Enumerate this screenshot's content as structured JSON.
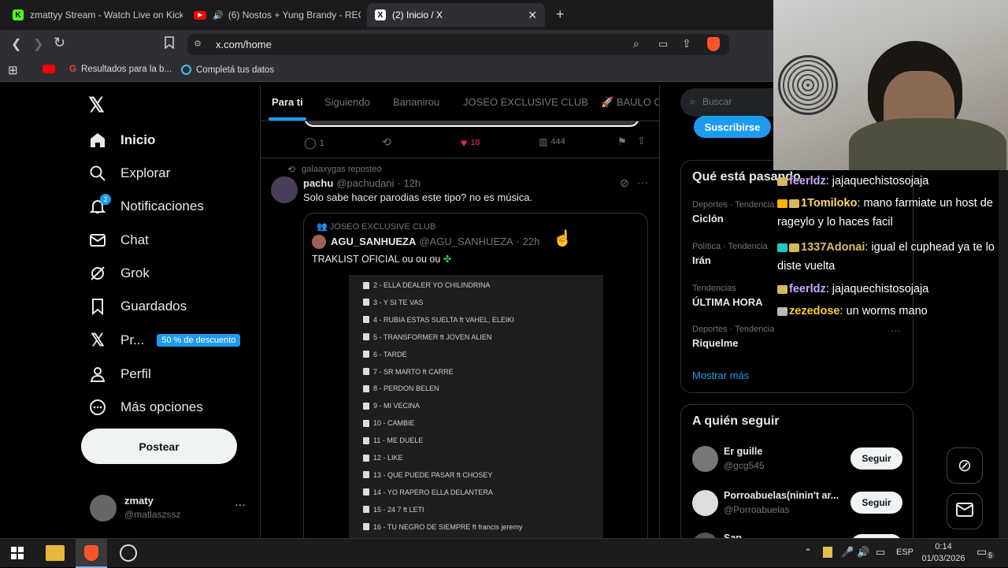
{
  "browser": {
    "tabs": [
      {
        "label": "zmattyy Stream - Watch Live on Kick",
        "icon": "kick-icon"
      },
      {
        "label": "(6) Nostos + Yung Brandy - RECU",
        "icon": "youtube-icon"
      },
      {
        "label": "(2) Inicio / X",
        "icon": "x-logo-icon"
      }
    ],
    "url": "x.com/home",
    "bookmarks": [
      "Resultados para la b...",
      "Completá tus datos"
    ]
  },
  "nav": {
    "items": [
      "Inicio",
      "Explorar",
      "Notificaciones",
      "Chat",
      "Grok",
      "Guardados",
      "Pr...",
      "Perfil",
      "Más opciones"
    ],
    "premium_badge": "50 % de descuento",
    "notif_count": "2",
    "post_button": "Postear",
    "account": {
      "name": "zmaty",
      "handle": "@matlaszssz"
    }
  },
  "feed": {
    "tabs": [
      "Para ti",
      "Siguiendo",
      "Bananirou",
      "JOSEO EXCLUSIVE CLUB",
      "BAULO CL"
    ],
    "prev_actions": {
      "replies": "1",
      "likes": "18",
      "views": "444"
    },
    "tweet": {
      "repost": "galaaxygas reposteó",
      "name": "pachu",
      "handle": "@pachudani",
      "time": "· 12h",
      "text": "Solo sabe hacer parodias este tipo? no es música.",
      "quote": {
        "community": "JOSEO EXCLUSIVE CLUB",
        "name": "AGU_SANHUEZA",
        "handle": "@AGU_SANHUEZA",
        "time": "· 22h",
        "text": "TRAKLIST OFICIAL ou ou ou",
        "tracks": [
          "2 - ELLA DEALER YO CHILINDRINA",
          "3 - Y SI TE VAS",
          "4 - RUBIA ESTAS SUELTA ft VAHEL, ELEIKI",
          "5 - TRANSFORMER ft JOVEN ALIEN",
          "6 - TARDE",
          "7 - SR MARTO ft CARRE",
          "8 - PERDON BELEN",
          "9 - MI VECINA",
          "10 - CAMBIE",
          "11 - ME DUELE",
          "12 - LIKE",
          "13 - QUE PUEDE PASAR ft CHOSEY",
          "14 - YO RAPERO ELLA DELANTERA",
          "15 - 24 7 ft LETI",
          "16 - TU NEGRO DE SIEMPRE ft francis jeremy"
        ]
      }
    }
  },
  "sidebar": {
    "search_placeholder": "Buscar",
    "subscribe": "Suscribirse",
    "trends_title": "Qué está pasando",
    "trends": [
      {
        "cat": "Deportes · Tendencia",
        "name": "Ciclón"
      },
      {
        "cat": "Política · Tendencia",
        "name": "Irán"
      },
      {
        "cat": "Tendencias",
        "name": "ÚLTIMA HORA"
      },
      {
        "cat": "Deportes · Tendencia",
        "name": "Riquelme"
      }
    ],
    "show_more": "Mostrar más",
    "follow_title": "A quién seguir",
    "follow": [
      {
        "name": "Er guille",
        "handle": "@gcg545",
        "btn": "Seguir"
      },
      {
        "name": "Porroabuelas(ninin't ar...",
        "handle": "@Porroabuelas",
        "btn": "Seguir"
      },
      {
        "name": "Sap",
        "handle": "",
        "btn": "Seguir"
      }
    ]
  },
  "chat": [
    {
      "user": "feerldz",
      "color": "#c8a8ff",
      "msg": ": jajaquechistosojaja"
    },
    {
      "user": "1Tomiloko",
      "color": "#ffd966",
      "msg": ": mano farmiate un host de rageylo y lo haces facil"
    },
    {
      "user": "1337Adonai",
      "color": "#d9c06a",
      "msg": ": igual el cuphead ya te lo diste vuelta"
    },
    {
      "user": "feerldz",
      "color": "#c8a8ff",
      "msg": ": jajaquechistosojaja"
    },
    {
      "user": "zezedose",
      "color": "#ffcc33",
      "msg": ": un worms mano"
    }
  ],
  "taskbar": {
    "lang": "ESP",
    "time": "0:14",
    "date": "01/03/2026",
    "notif": "5"
  }
}
